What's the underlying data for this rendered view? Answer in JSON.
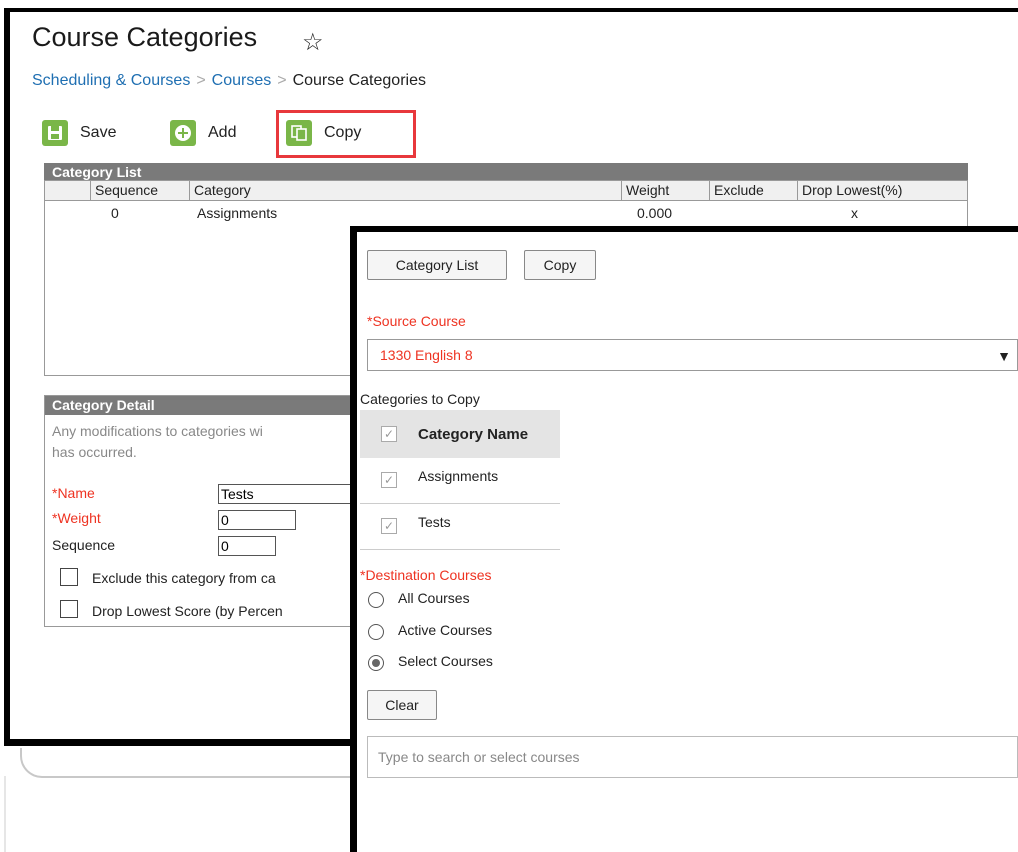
{
  "page": {
    "title": "Course Categories",
    "breadcrumb": [
      "Scheduling & Courses",
      "Courses",
      "Course Categories"
    ]
  },
  "toolbar": {
    "save_label": "Save",
    "add_label": "Add",
    "copy_label": "Copy"
  },
  "category_list": {
    "header": "Category List",
    "columns": [
      "Sequence",
      "Category",
      "Weight",
      "Exclude",
      "Drop Lowest(%)"
    ],
    "rows": [
      {
        "sequence": "0",
        "category": "Assignments",
        "weight": "0.000",
        "exclude": "",
        "drop_lowest": "x"
      }
    ]
  },
  "category_detail": {
    "header": "Category Detail",
    "note_line1": "Any modifications to categories wi",
    "note_line2": "has occurred.",
    "name_label": "*Name",
    "name_value": "Tests",
    "weight_label": "*Weight",
    "weight_value": "0",
    "sequence_label": "Sequence",
    "sequence_value": "0",
    "exclude_label": "Exclude this category from ca",
    "drop_label": "Drop Lowest Score (by Percen"
  },
  "copy_modal": {
    "tab_category_list": "Category List",
    "tab_copy": "Copy",
    "source_course_label": "*Source Course",
    "source_course_value": "1330 English 8",
    "categories_to_copy_label": "Categories to Copy",
    "category_name_header": "Category Name",
    "categories": [
      "Assignments",
      "Tests"
    ],
    "destination_label": "*Destination Courses",
    "destination_options": [
      "All Courses",
      "Active Courses",
      "Select Courses"
    ],
    "selected_destination": "Select Courses",
    "clear_label": "Clear",
    "search_placeholder": "Type to search or select courses"
  },
  "colors": {
    "link_blue": "#1f6fb2",
    "required_red": "#e32222",
    "toolbar_green": "#7ab648",
    "highlight_red": "#e8383c",
    "panel_header_gray": "#7a7a7a"
  }
}
